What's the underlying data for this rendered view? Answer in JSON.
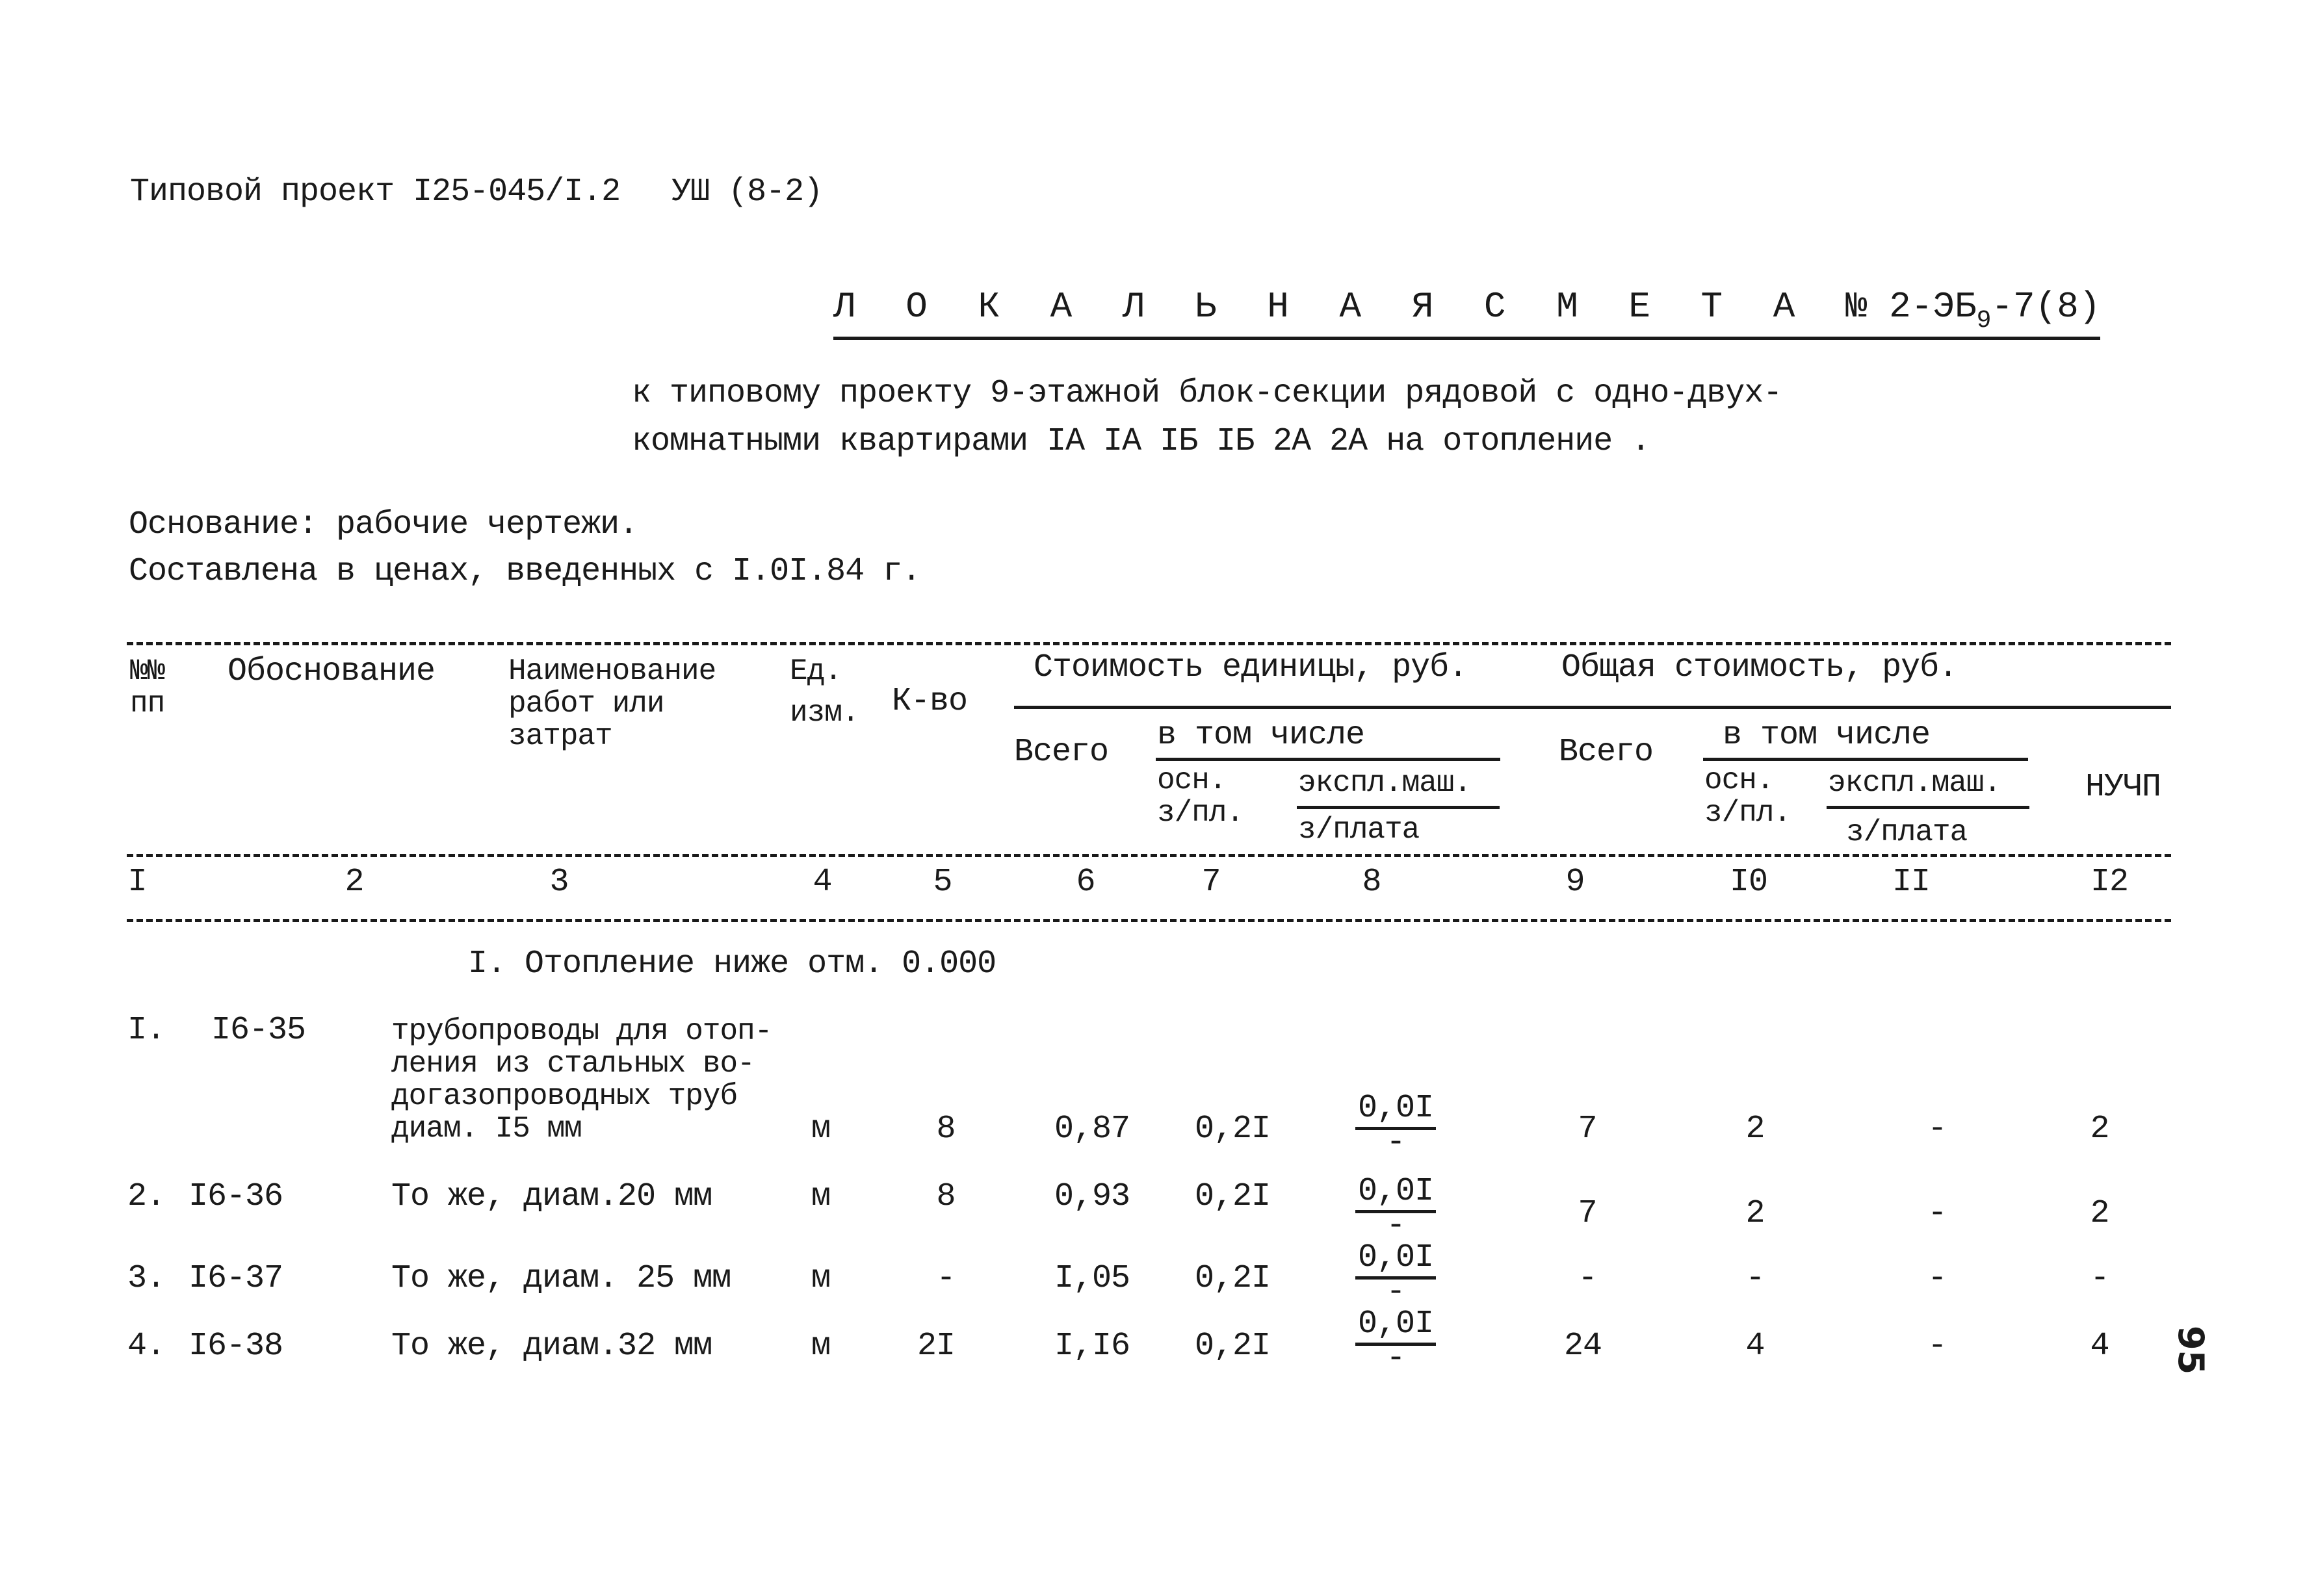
{
  "header": {
    "project_ref": "Типовой проект I25-045/I.2",
    "album_ref": "УШ (8-2)"
  },
  "title": {
    "label": "Л О К А Л Ь Н А Я   С М Е Т А",
    "number_prefix": "№ 2-ЭБ",
    "number_sub": "9",
    "number_suffix": "-7(8)"
  },
  "subtitle": {
    "line1": "к типовому проекту 9-этажной блок-секции рядовой с одно-двух-",
    "line2": "комнатными квартирами IA IA IБ IБ 2A 2A на отопление ."
  },
  "basis": {
    "line1": "Основание:  рабочие чертежи.",
    "line2": "Составлена в ценах, введенных с I.0I.84 г."
  },
  "table": {
    "headers": {
      "num": "№№\nпп",
      "num_l1": "№№",
      "num_l2": "пп",
      "basis": "Обоснование",
      "name_l1": "Наименование",
      "name_l2": "работ или",
      "name_l3": "затрат",
      "unit_l1": "Ед.",
      "unit_l2": "изм.",
      "qty": "К-во",
      "unit_cost_group": "Стоимость единицы,  руб.",
      "total_cost_group": "Общая стоимость, руб.",
      "total": "Всего",
      "incl": "в том числе",
      "base_wage_l1": "осн.",
      "base_wage_l2": "з/пл.",
      "machine_l1": "экспл.маш.",
      "machine_l2": "з/плата",
      "nuchp": "НУЧП"
    },
    "column_numbers": [
      "I",
      "2",
      "3",
      "4",
      "5",
      "6",
      "7",
      "8",
      "9",
      "I0",
      "II",
      "I2"
    ],
    "section_title": "I. Отопление ниже отм. 0.000",
    "rows": [
      {
        "n": "I.",
        "code": "I6-35",
        "name_lines": [
          "трубопроводы для отоп-",
          "ления из стальных во-",
          "догазопроводных труб",
          "диам. I5 мм"
        ],
        "unit": "м",
        "qty": "8",
        "unit_total": "0,87",
        "unit_base_wage": "0,2I",
        "unit_machine": "0,0I",
        "unit_machine_wage": "-",
        "total": "7",
        "total_base_wage": "2",
        "total_machine": "-",
        "nuchp": "2"
      },
      {
        "n": "2.",
        "code": "I6-36",
        "name_lines": [
          "То же, диам.20 мм"
        ],
        "unit": "м",
        "qty": "8",
        "unit_total": "0,93",
        "unit_base_wage": "0,2I",
        "unit_machine": "0,0I",
        "unit_machine_wage": "-",
        "total": "7",
        "total_base_wage": "2",
        "total_machine": "-",
        "nuchp": "2"
      },
      {
        "n": "3.",
        "code": "I6-37",
        "name_lines": [
          "То же, диам. 25 мм"
        ],
        "unit": "м",
        "qty": "-",
        "unit_total": "I,05",
        "unit_base_wage": "0,2I",
        "unit_machine": "0,0I",
        "unit_machine_wage": "-",
        "total": "-",
        "total_base_wage": "-",
        "total_machine": "-",
        "nuchp": "-"
      },
      {
        "n": "4.",
        "code": "I6-38",
        "name_lines": [
          "То же, диам.32 мм"
        ],
        "unit": "м",
        "qty": "2I",
        "unit_total": "I,I6",
        "unit_base_wage": "0,2I",
        "unit_machine": "0,0I",
        "unit_machine_wage": "-",
        "total": "24",
        "total_base_wage": "4",
        "total_machine": "-",
        "nuchp": "4"
      }
    ]
  },
  "page_number": "95"
}
